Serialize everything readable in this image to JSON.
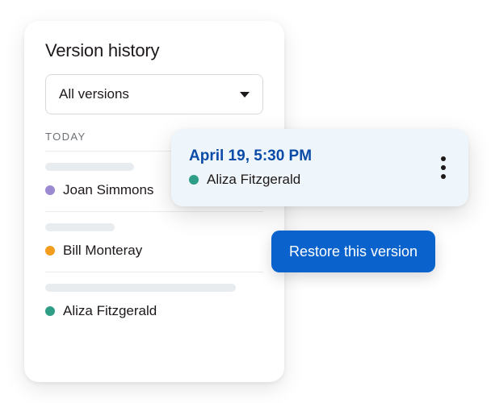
{
  "panel": {
    "title": "Version history",
    "filter": {
      "label": "All versions"
    },
    "section_label": "TODAY",
    "rows": [
      {
        "skel_width": 110,
        "dot_color": "#9b8ad1",
        "name": "Joan Simmons"
      },
      {
        "skel_width": 86,
        "dot_color": "#f29d1d",
        "name": "Bill Monteray"
      },
      {
        "skel_width": 236,
        "dot_color": "#2f9e87",
        "name": "Aliza Fitzgerald"
      }
    ]
  },
  "popover": {
    "timestamp": "April 19, 5:30 PM",
    "dot_color": "#2f9e87",
    "name": "Aliza Fitzgerald"
  },
  "restore_label": "Restore this version"
}
